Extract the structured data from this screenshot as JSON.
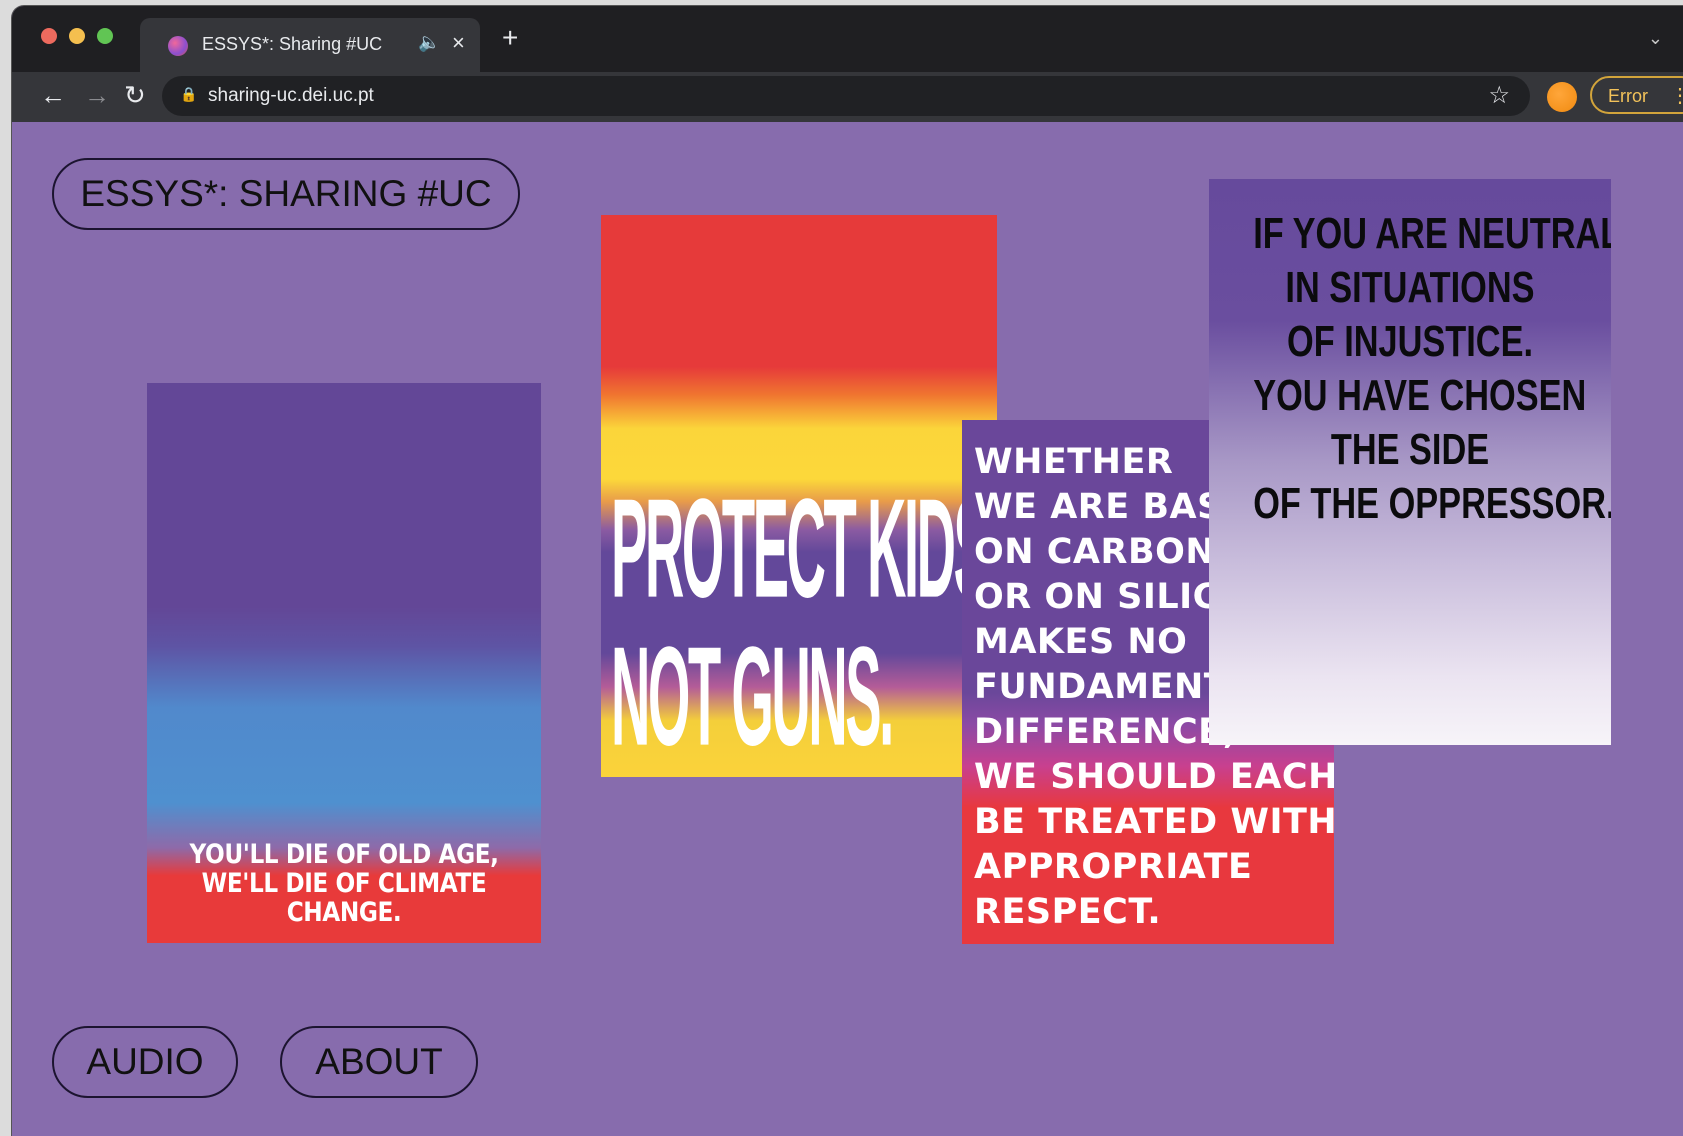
{
  "browser": {
    "tab_title": "ESSYS*: Sharing #UC",
    "tab_audio_icon": "speaker-icon",
    "tab_close": "×",
    "new_tab": "+",
    "url": "sharing-uc.dei.uc.pt",
    "error_label": "Error",
    "menu_dots": "⋮"
  },
  "page": {
    "title_button": "ESSYS*: SHARING #UC",
    "audio_button": "AUDIO",
    "about_button": "ABOUT"
  },
  "posters": {
    "climate": {
      "line1": "YOU'LL DIE OF OLD AGE,",
      "line2": "WE'LL DIE OF CLIMATE CHANGE."
    },
    "guns": {
      "line1": "PROTECT KIDS",
      "line2": "NOT GUNS."
    },
    "respect": {
      "lines": [
        "WHETHER",
        "WE ARE BAS",
        "ON CARBON",
        "OR ON SILIC",
        "MAKES NO",
        "FUNDAMENT",
        "DIFFERENCE;",
        "WE SHOULD EACH",
        "BE TREATED WITH",
        "APPROPRIATE",
        "RESPECT."
      ]
    },
    "neutral": {
      "lines": [
        "IF YOU ARE NEUTRAL",
        "IN SITUATIONS",
        "OF INJUSTICE.",
        "YOU HAVE CHOSEN",
        "THE SIDE",
        "OF THE OPPRESSOR."
      ]
    }
  },
  "colors": {
    "page_bg": "#876cad",
    "poster_red": "#e83a3a",
    "poster_purple": "#634797",
    "poster_yellow": "#fbd53a"
  }
}
